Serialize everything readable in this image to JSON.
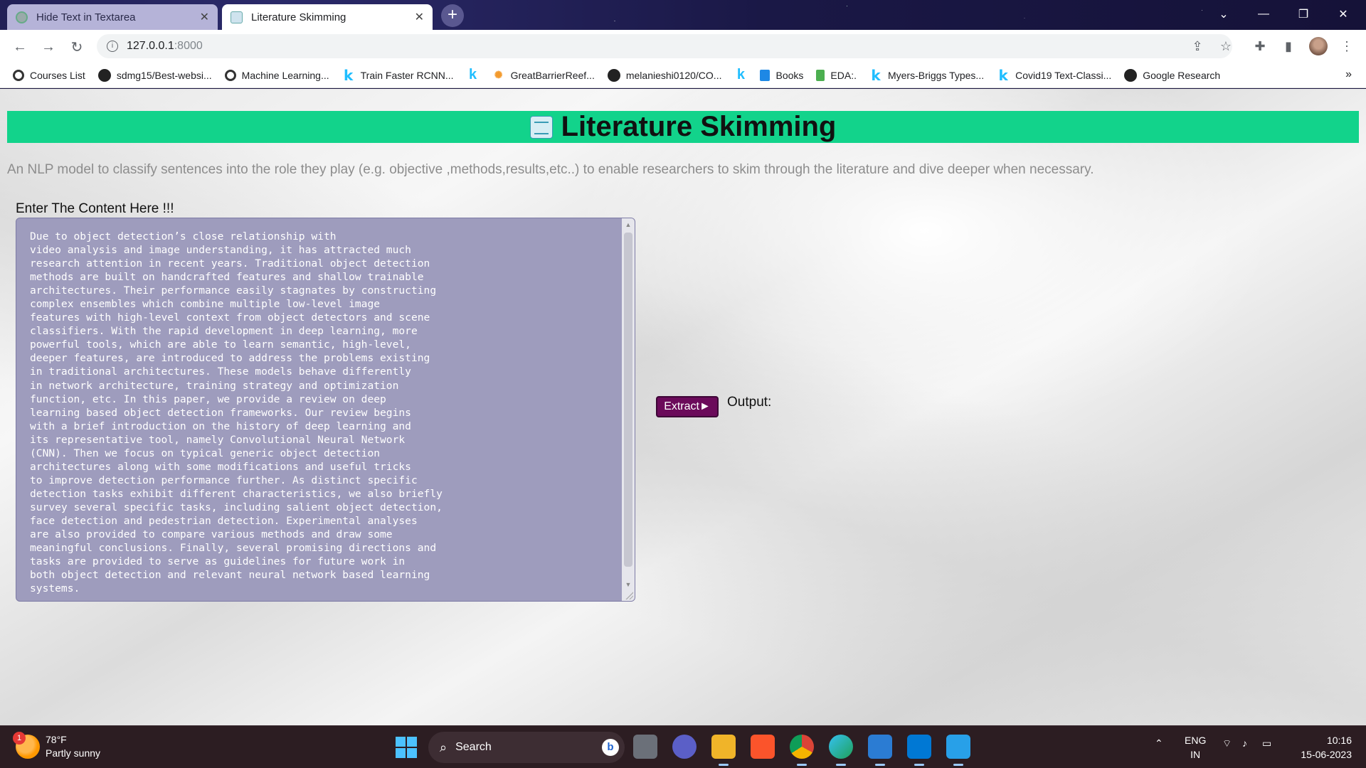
{
  "browser": {
    "tabs": [
      {
        "title": "Hide Text in Textarea",
        "active": false
      },
      {
        "title": "Literature Skimming",
        "active": true
      }
    ],
    "new_tab": "+",
    "url_host": "127.0.0.1",
    "url_port": ":8000",
    "bookmarks": [
      {
        "label": "Courses List",
        "icon": "google-icon"
      },
      {
        "label": "sdmg15/Best-websi...",
        "icon": "github-icon"
      },
      {
        "label": "Machine Learning...",
        "icon": "google-icon"
      },
      {
        "label": "Train Faster RCNN...",
        "icon": "kaggle-icon"
      },
      {
        "label": "",
        "icon": "kaggle-icon"
      },
      {
        "label": "GreatBarrierReef...",
        "icon": "gbr-icon"
      },
      {
        "label": "melanieshi0120/CO...",
        "icon": "github-icon"
      },
      {
        "label": "",
        "icon": "kaggle-icon"
      },
      {
        "label": "Books",
        "icon": "folder-blue-icon"
      },
      {
        "label": "EDA:.",
        "icon": "folder-green-icon"
      },
      {
        "label": "Myers-Briggs Types...",
        "icon": "kaggle-icon"
      },
      {
        "label": "Covid19 Text-Classi...",
        "icon": "kaggle-icon"
      },
      {
        "label": "Google Research",
        "icon": "github-icon"
      }
    ],
    "bookmarks_more": "»"
  },
  "page": {
    "title": "Literature Skimming",
    "description": "An NLP model to classify sentences into the role they play (e.g. objective ,methods,results,etc..) to enable researchers to skim through the literature and dive deeper when necessary.",
    "input_label": "Enter The Content Here !!!",
    "content": "Due to object detection’s close relationship with\nvideo analysis and image understanding, it has attracted much\nresearch attention in recent years. Traditional object detection\nmethods are built on handcrafted features and shallow trainable\narchitectures. Their performance easily stagnates by constructing\ncomplex ensembles which combine multiple low-level image\nfeatures with high-level context from object detectors and scene\nclassifiers. With the rapid development in deep learning, more\npowerful tools, which are able to learn semantic, high-level,\ndeeper features, are introduced to address the problems existing\nin traditional architectures. These models behave differently\nin network architecture, training strategy and optimization\nfunction, etc. In this paper, we provide a review on deep\nlearning based object detection frameworks. Our review begins\nwith a brief introduction on the history of deep learning and\nits representative tool, namely Convolutional Neural Network\n(CNN). Then we focus on typical generic object detection\narchitectures along with some modifications and useful tricks\nto improve detection performance further. As distinct specific\ndetection tasks exhibit different characteristics, we also briefly\nsurvey several specific tasks, including salient object detection,\nface detection and pedestrian detection. Experimental analyses\nare also provided to compare various methods and draw some\nmeaningful conclusions. Finally, several promising directions and\ntasks are provided to serve as guidelines for future work in\nboth object detection and relevant neural network based learning\nsystems.",
    "extract_button": "Extract►",
    "output_label": "Output:"
  },
  "taskbar": {
    "weather_temp": "78°F",
    "weather_desc": "Partly sunny",
    "weather_badge": "1",
    "search_label": "Search",
    "lang_top": "ENG",
    "lang_bottom": "IN",
    "time": "10:16",
    "date": "15-06-2023"
  },
  "colors": {
    "banner": "#12d38b",
    "textarea_bg": "#9e9cbd",
    "extract_button": "#6b0a5a"
  }
}
